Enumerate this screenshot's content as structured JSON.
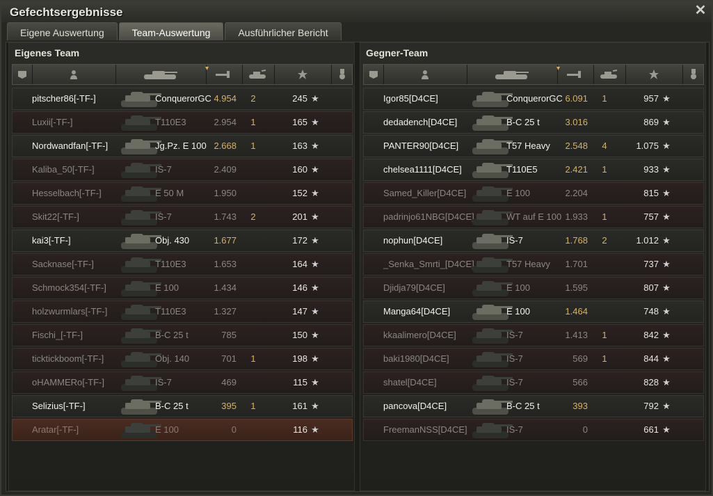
{
  "window": {
    "title": "Gefechtsergebnisse",
    "close_symbol": "✕"
  },
  "tabs": [
    {
      "label": "Eigene Auswertung",
      "active": false
    },
    {
      "label": "Team-Auswertung",
      "active": true
    },
    {
      "label": "Ausführlicher Bericht",
      "active": false
    }
  ],
  "columns": [
    "platoon-icon",
    "player-icon",
    "tank-icon",
    "damage-icon",
    "kills-icon",
    "star-icon",
    "medal-icon"
  ],
  "sorted_column": "damage",
  "star_symbol": "★",
  "colors": {
    "damage": "#d7b25f",
    "text": "#f2f2ea",
    "dim": "#8a8680"
  },
  "own_team": {
    "title": "Eigenes Team",
    "rows": [
      {
        "player": "pitscher86[-TF-]",
        "vehicle": "ConquerorGC",
        "damage": "4.954",
        "kills": "2",
        "xp": "245",
        "status": "alive"
      },
      {
        "player": "Luxii[-TF-]",
        "vehicle": "T110E3",
        "damage": "2.954",
        "kills": "1",
        "xp": "165",
        "status": "dead"
      },
      {
        "player": "Nordwandfan[-TF-]",
        "vehicle": "Jg.Pz. E 100",
        "damage": "2.668",
        "kills": "1",
        "xp": "163",
        "status": "alive"
      },
      {
        "player": "Kaliba_50[-TF-]",
        "vehicle": "IS-7",
        "damage": "2.409",
        "kills": "",
        "xp": "160",
        "status": "dead"
      },
      {
        "player": "Hesselbach[-TF-]",
        "vehicle": "E 50 M",
        "damage": "1.950",
        "kills": "",
        "xp": "152",
        "status": "dead"
      },
      {
        "player": "Skit22[-TF-]",
        "vehicle": "IS-7",
        "damage": "1.743",
        "kills": "2",
        "xp": "201",
        "status": "dead"
      },
      {
        "player": "kai3[-TF-]",
        "vehicle": "Obj. 430",
        "damage": "1.677",
        "kills": "",
        "xp": "172",
        "status": "alive"
      },
      {
        "player": "Sacknase[-TF-]",
        "vehicle": "T110E3",
        "damage": "1.653",
        "kills": "",
        "xp": "164",
        "status": "dead"
      },
      {
        "player": "Schmock354[-TF-]",
        "vehicle": "E 100",
        "damage": "1.434",
        "kills": "",
        "xp": "146",
        "status": "dead"
      },
      {
        "player": "holzwurmlars[-TF-]",
        "vehicle": "T110E3",
        "damage": "1.327",
        "kills": "",
        "xp": "147",
        "status": "dead"
      },
      {
        "player": "Fischi_[-TF-]",
        "vehicle": "B-C 25 t",
        "damage": "785",
        "kills": "",
        "xp": "150",
        "status": "dead"
      },
      {
        "player": "ticktickboom[-TF-]",
        "vehicle": "Obj. 140",
        "damage": "701",
        "kills": "1",
        "xp": "198",
        "status": "dead"
      },
      {
        "player": "oHAMMERo[-TF-]",
        "vehicle": "IS-7",
        "damage": "469",
        "kills": "",
        "xp": "115",
        "status": "dead"
      },
      {
        "player": "Selizius[-TF-]",
        "vehicle": "B-C 25 t",
        "damage": "395",
        "kills": "1",
        "xp": "161",
        "status": "alive"
      },
      {
        "player": "Aratar[-TF-]",
        "vehicle": "E 100",
        "damage": "0",
        "kills": "",
        "xp": "116",
        "status": "dead-hl"
      }
    ]
  },
  "enemy_team": {
    "title": "Gegner-Team",
    "rows": [
      {
        "player": "Igor85[D4CE]",
        "vehicle": "ConquerorGC",
        "damage": "6.091",
        "kills": "1",
        "xp": "957",
        "status": "alive"
      },
      {
        "player": "dedadench[D4CE]",
        "vehicle": "B-C 25 t",
        "damage": "3.016",
        "kills": "",
        "xp": "869",
        "status": "alive"
      },
      {
        "player": "PANTER90[D4CE]",
        "vehicle": "T57 Heavy",
        "damage": "2.548",
        "kills": "4",
        "xp": "1.075",
        "status": "alive"
      },
      {
        "player": "chelsea1111[D4CE]",
        "vehicle": "T110E5",
        "damage": "2.421",
        "kills": "1",
        "xp": "933",
        "status": "alive"
      },
      {
        "player": "Samed_Killer[D4CE]",
        "vehicle": "E 100",
        "damage": "2.204",
        "kills": "",
        "xp": "815",
        "status": "dead"
      },
      {
        "player": "padrinjo61NBG[D4CE]",
        "vehicle": "WT auf E 100",
        "damage": "1.933",
        "kills": "1",
        "xp": "757",
        "status": "dead"
      },
      {
        "player": "nophun[D4CE]",
        "vehicle": "IS-7",
        "damage": "1.768",
        "kills": "2",
        "xp": "1.012",
        "status": "alive"
      },
      {
        "player": "_Senka_Smrti_[D4CE]",
        "vehicle": "T57 Heavy",
        "damage": "1.701",
        "kills": "",
        "xp": "737",
        "status": "dead"
      },
      {
        "player": "Djidja79[D4CE]",
        "vehicle": "E 100",
        "damage": "1.595",
        "kills": "",
        "xp": "807",
        "status": "dead"
      },
      {
        "player": "Manga64[D4CE]",
        "vehicle": "E 100",
        "damage": "1.464",
        "kills": "",
        "xp": "748",
        "status": "alive"
      },
      {
        "player": "kkaalimero[D4CE]",
        "vehicle": "IS-7",
        "damage": "1.413",
        "kills": "1",
        "xp": "842",
        "status": "dead"
      },
      {
        "player": "baki1980[D4CE]",
        "vehicle": "IS-7",
        "damage": "569",
        "kills": "1",
        "xp": "844",
        "status": "dead"
      },
      {
        "player": "shatel[D4CE]",
        "vehicle": "IS-7",
        "damage": "566",
        "kills": "",
        "xp": "828",
        "status": "dead"
      },
      {
        "player": "pancova[D4CE]",
        "vehicle": "B-C 25 t",
        "damage": "393",
        "kills": "",
        "xp": "792",
        "status": "alive"
      },
      {
        "player": "FreemanNSS[D4CE]",
        "vehicle": "IS-7",
        "damage": "0",
        "kills": "",
        "xp": "661",
        "status": "dead"
      }
    ]
  }
}
